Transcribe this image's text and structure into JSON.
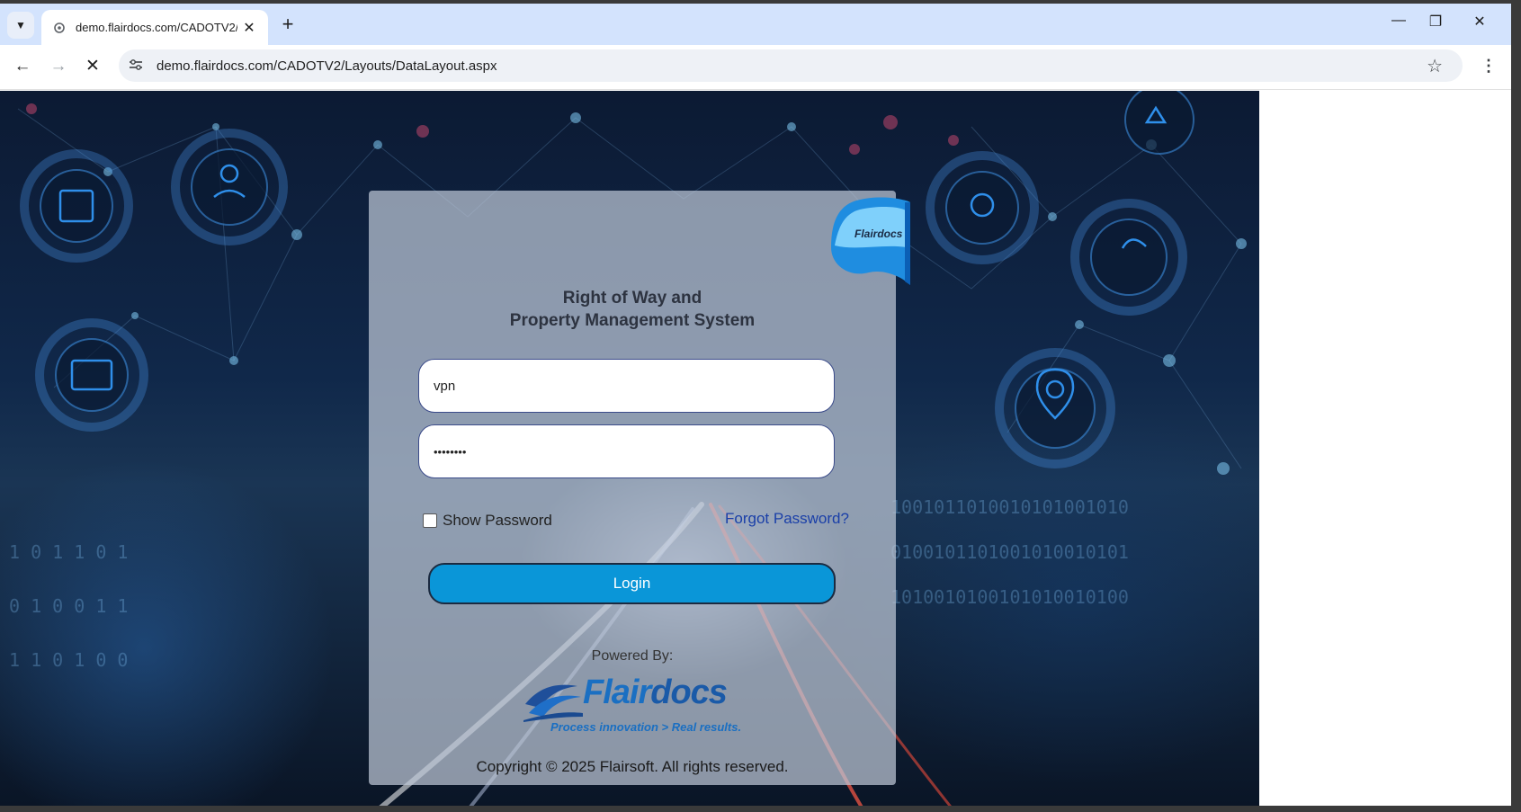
{
  "browser": {
    "tab_title": "demo.flairdocs.com/CADOTV2/",
    "url": "demo.flairdocs.com/CADOTV2/Layouts/DataLayout.aspx"
  },
  "login": {
    "title_line1": "Right of Way and",
    "title_line2": "Property Management System",
    "username_value": "vpn",
    "password_value": "••••••••",
    "show_password_label": "Show Password",
    "forgot_password_label": "Forgot Password?",
    "login_label": "Login",
    "powered_by": "Powered By:",
    "badge_text": "Flairdocs",
    "logo_text_a": "Flair",
    "logo_text_b": "docs",
    "tagline": "Process innovation > Real results.",
    "copyright": "Copyright © 2025 Flairsoft. All rights reserved."
  },
  "colors": {
    "tabstrip": "#d3e3fd",
    "login_button": "#0a96d8",
    "link": "#1a3fa8",
    "brand_blue": "#1a6fc2"
  },
  "icons": [
    "chevron-down-icon",
    "favicon-icon",
    "close-icon",
    "plus-icon",
    "minimize-icon",
    "restore-icon",
    "back-icon",
    "forward-icon",
    "stop-icon",
    "site-info-icon",
    "star-icon",
    "more-icon"
  ]
}
